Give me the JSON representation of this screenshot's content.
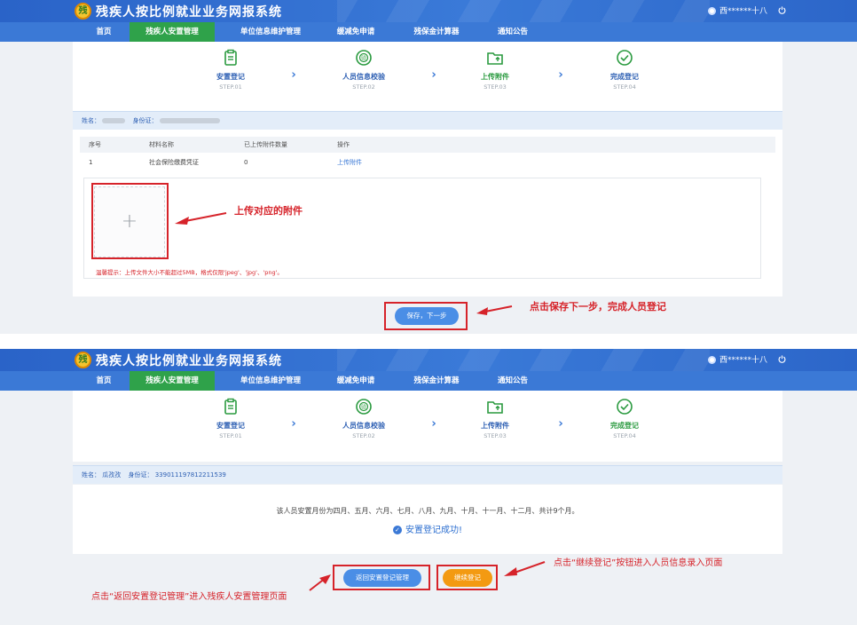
{
  "app": {
    "title": "残疾人按比例就业业务网报系统",
    "logo_text": "残",
    "user_1": "西******十八",
    "user_2": "西******十八",
    "power_icon": "power-icon"
  },
  "nav": [
    "首页",
    "残疾人安置管理",
    "单位信息维护管理",
    "缓减免申请",
    "残保金计算器",
    "通知公告"
  ],
  "steps": [
    {
      "label": "安置登记",
      "sub": "STEP.01",
      "icon": "clipboard-icon"
    },
    {
      "label": "人员信息校验",
      "sub": "STEP.02",
      "icon": "verify-icon"
    },
    {
      "label": "上传附件",
      "sub": "STEP.03",
      "icon": "upload-folder-icon"
    },
    {
      "label": "完成登记",
      "sub": "STEP.04",
      "icon": "check-circle-icon"
    }
  ],
  "step_arrow": "›",
  "screen1": {
    "name_label": "姓名：",
    "id_label": "身份证：",
    "table_headers": [
      "序号",
      "材料名称",
      "已上传附件数量",
      "操作"
    ],
    "table_rows": [
      {
        "index": "1",
        "material": "社会保险缴费凭证",
        "count": "0",
        "action": "上传附件"
      }
    ],
    "upload_plus": "+",
    "annotation_upload": "上传对应的附件",
    "warning": "温馨提示：上传文件大小不能超过5MB，格式仅限'jpeg'、'jpg'、'png'。",
    "save_next_button": "保存，下一步",
    "annotation_save": "点击保存下一步，完成人员登记"
  },
  "screen2": {
    "name_label": "姓名：",
    "name_value": "瓜孜孜",
    "id_label": "身份证：",
    "id_value": "339011197812211539",
    "months_text": "该人员安置月份为四月、五月、六月、七月、八月、九月、十月、十一月、十二月、共计9个月。",
    "success_text": "安置登记成功!",
    "back_button": "返回安置登记管理",
    "continue_button": "继续登记",
    "annotation_continue": "点击“继续登记”按钮进入人员信息录入页面",
    "annotation_back": "点击“返回安置登记管理”进入残疾人安置管理页面"
  },
  "colors": {
    "header_blue": "#2a63c8",
    "nav_blue": "#3b79d6",
    "nav_active_green": "#2fa24a",
    "annotation_red": "#d6232a",
    "button_blue": "#4a8ee6",
    "button_orange": "#f39a12"
  }
}
